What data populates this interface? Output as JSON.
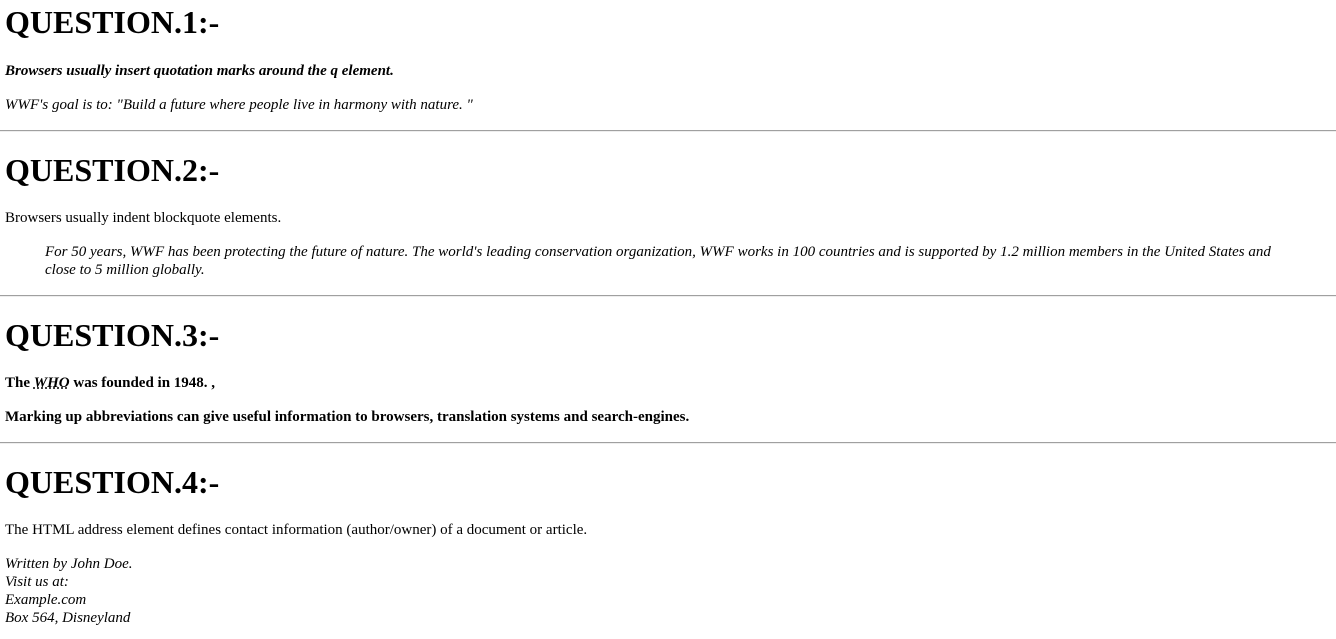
{
  "q1": {
    "title": "QUESTION.1:-",
    "intro": "Browsers usually insert quotation marks around the q element.",
    "quote_prefix": "WWF's goal is to: ",
    "quote_text": "\"Build a future where people live in harmony with nature. \""
  },
  "q2": {
    "title": "QUESTION.2:-",
    "intro": "Browsers usually indent blockquote elements.",
    "blockquote": "For 50 years, WWF has been protecting the future of nature. The world's leading conservation organization, WWF works in 100 countries and is supported by 1.2 million members in the United States and close to 5 million globally."
  },
  "q3": {
    "title": "QUESTION.3:-",
    "line1_prefix": "The ",
    "abbr": "WHO",
    "line1_suffix": " was founded in 1948. ,",
    "line2": "Marking up abbreviations can give useful information to browsers, translation systems and search-engines."
  },
  "q4": {
    "title": "QUESTION.4:-",
    "intro": "The HTML address element defines contact information (author/owner) of a document or article.",
    "address": [
      "Written by John Doe.",
      "Visit us at:",
      "Example.com",
      "Box 564, Disneyland"
    ]
  }
}
